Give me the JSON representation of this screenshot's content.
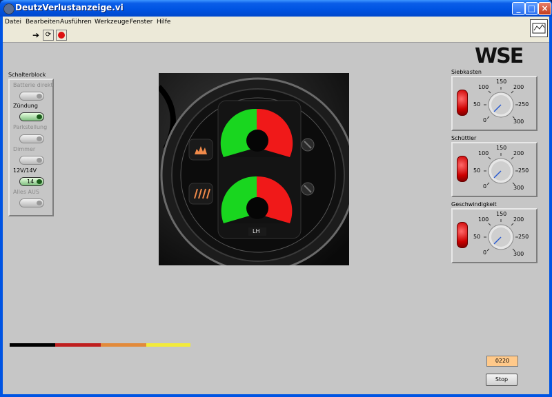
{
  "window": {
    "title": "DeutzVerlustanzeige.vi"
  },
  "menu": [
    "Datei",
    "Bearbeiten",
    "Ausführen",
    "Werkzeuge",
    "Fenster",
    "Hilfe"
  ],
  "toolbar": {
    "run": "run-arrow-icon",
    "continuous": "run-continuous-icon",
    "abort": "abort-icon"
  },
  "logo": "WSE",
  "schalterblock": {
    "title": "Schalterblock",
    "switches": [
      {
        "label": "Batterie direkt",
        "on": false,
        "enabled": false
      },
      {
        "label": "Zündung",
        "on": true,
        "enabled": true
      },
      {
        "label": "Parkstellung",
        "on": false,
        "enabled": false
      },
      {
        "label": "Dimmer",
        "on": false,
        "enabled": false
      },
      {
        "label": "12V/14V",
        "on": true,
        "enabled": true,
        "text": "14"
      },
      {
        "label": "Alles AUS",
        "on": false,
        "enabled": false
      }
    ]
  },
  "gauges": [
    {
      "title": "Siebkasten",
      "ticks": [
        "0",
        "50",
        "100",
        "150",
        "200",
        "250",
        "300"
      ],
      "value": 0
    },
    {
      "title": "Schüttler",
      "ticks": [
        "0",
        "50",
        "100",
        "150",
        "200",
        "250",
        "300"
      ],
      "value": 0
    },
    {
      "title": "Geschwindigkeit",
      "ticks": [
        "0",
        "50",
        "100",
        "150",
        "200",
        "250",
        "300"
      ],
      "value": 0
    }
  ],
  "photo": {
    "badge": "LH"
  },
  "status_value": "0220",
  "stop_label": "Stop",
  "colors": {
    "green": "#18d81f",
    "red": "#f01a1a",
    "stripes": [
      "#000000",
      "#bf1e1e",
      "#e28a3a",
      "#f2ea3a"
    ]
  }
}
